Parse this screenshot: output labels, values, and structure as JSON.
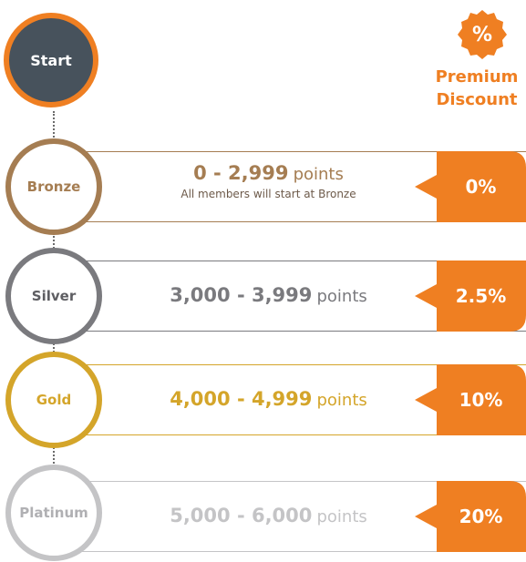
{
  "start": {
    "label": "Start"
  },
  "header": {
    "premium_line1": "Premium",
    "premium_line2": "Discount",
    "badge_symbol": "%"
  },
  "tiers": [
    {
      "name": "Bronze",
      "range": "0 - 2,999",
      "points_word": "points",
      "note": "All members will start at Bronze",
      "discount": "0%",
      "color": "#a57d52"
    },
    {
      "name": "Silver",
      "range": "3,000 - 3,999",
      "points_word": "points",
      "note": "",
      "discount": "2.5%",
      "color": "#7a7a7e"
    },
    {
      "name": "Gold",
      "range": "4,000 - 4,999",
      "points_word": "points",
      "note": "",
      "discount": "10%",
      "color": "#d4a52a"
    },
    {
      "name": "Platinum",
      "range": "5,000 - 6,000",
      "points_word": "points",
      "note": "",
      "discount": "20%",
      "color": "#c4c4c6"
    }
  ],
  "colors": {
    "accent": "#ef7f22",
    "start_fill": "#47525c"
  }
}
